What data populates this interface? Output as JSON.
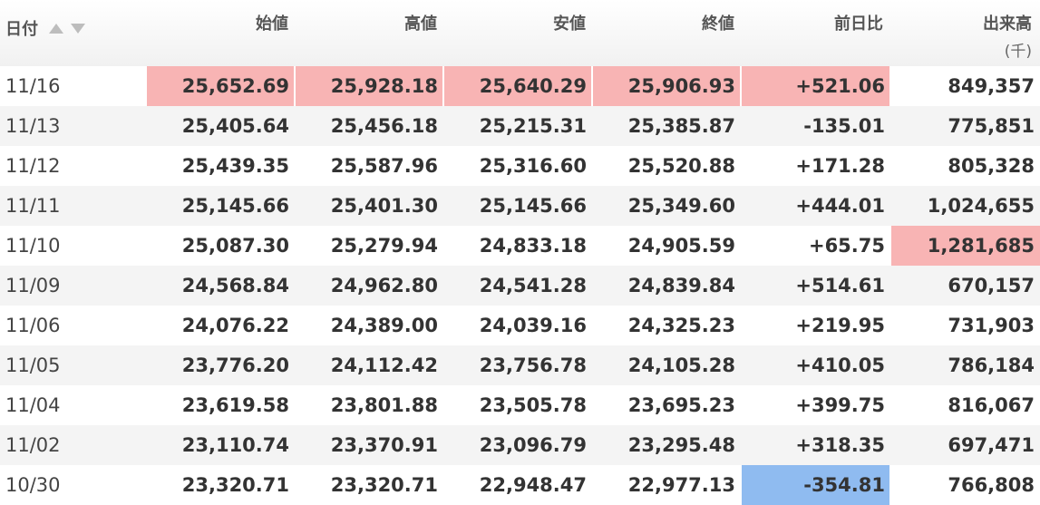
{
  "header": {
    "date": "日付",
    "open": "始値",
    "high": "高値",
    "low": "安値",
    "close": "終値",
    "change": "前日比",
    "volume": "出来高",
    "volume_unit": "(千)"
  },
  "colors": {
    "positive": "#e60012",
    "negative": "#1a63c8",
    "highlight_red": "#f8b4b4",
    "highlight_blue": "#8fbbf0"
  },
  "rows": [
    {
      "date": "11/16",
      "open": "25,652.69",
      "high": "25,928.18",
      "low": "25,640.29",
      "close": "25,906.93",
      "change": "+521.06",
      "volume": "849,357"
    },
    {
      "date": "11/13",
      "open": "25,405.64",
      "high": "25,456.18",
      "low": "25,215.31",
      "close": "25,385.87",
      "change": "-135.01",
      "volume": "775,851"
    },
    {
      "date": "11/12",
      "open": "25,439.35",
      "high": "25,587.96",
      "low": "25,316.60",
      "close": "25,520.88",
      "change": "+171.28",
      "volume": "805,328"
    },
    {
      "date": "11/11",
      "open": "25,145.66",
      "high": "25,401.30",
      "low": "25,145.66",
      "close": "25,349.60",
      "change": "+444.01",
      "volume": "1,024,655"
    },
    {
      "date": "11/10",
      "open": "25,087.30",
      "high": "25,279.94",
      "low": "24,833.18",
      "close": "24,905.59",
      "change": "+65.75",
      "volume": "1,281,685"
    },
    {
      "date": "11/09",
      "open": "24,568.84",
      "high": "24,962.80",
      "low": "24,541.28",
      "close": "24,839.84",
      "change": "+514.61",
      "volume": "670,157"
    },
    {
      "date": "11/06",
      "open": "24,076.22",
      "high": "24,389.00",
      "low": "24,039.16",
      "close": "24,325.23",
      "change": "+219.95",
      "volume": "731,903"
    },
    {
      "date": "11/05",
      "open": "23,776.20",
      "high": "24,112.42",
      "low": "23,756.78",
      "close": "24,105.28",
      "change": "+410.05",
      "volume": "786,184"
    },
    {
      "date": "11/04",
      "open": "23,619.58",
      "high": "23,801.88",
      "low": "23,505.78",
      "close": "23,695.23",
      "change": "+399.75",
      "volume": "816,067"
    },
    {
      "date": "11/02",
      "open": "23,110.74",
      "high": "23,370.91",
      "low": "23,096.79",
      "close": "23,295.48",
      "change": "+318.35",
      "volume": "697,471"
    },
    {
      "date": "10/30",
      "open": "23,320.71",
      "high": "23,320.71",
      "low": "22,948.47",
      "close": "22,977.13",
      "change": "-354.81",
      "volume": "766,808"
    }
  ]
}
